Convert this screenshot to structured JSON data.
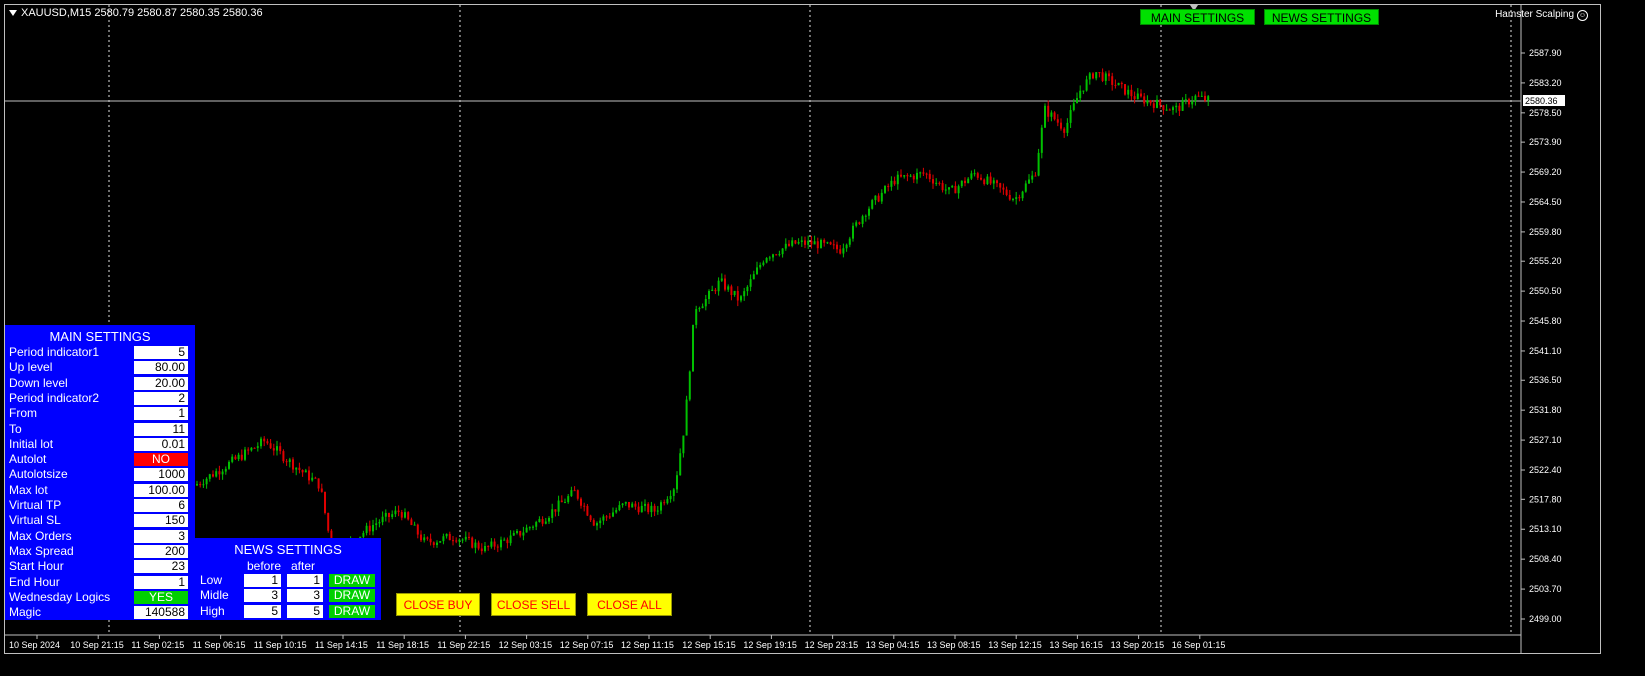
{
  "symbol_header": "XAUUSD,M15  2580.79 2580.87 2580.35 2580.36",
  "ea_name": "Hamster Scalping",
  "top_buttons": {
    "main": "MAIN SETTINGS",
    "news": "NEWS SETTINGS"
  },
  "current_price": "2580.36",
  "colors": {
    "bull": "#00c000",
    "bear": "#e00000",
    "panel": "#0000ff",
    "button_green": "#00e000",
    "button_yellow": "#ffff00"
  },
  "price_axis": [
    "2587.90",
    "2583.20",
    "2578.50",
    "2573.90",
    "2569.20",
    "2564.50",
    "2559.80",
    "2555.20",
    "2550.50",
    "2545.80",
    "2541.10",
    "2536.50",
    "2531.80",
    "2527.10",
    "2522.40",
    "2517.80",
    "2513.10",
    "2508.40",
    "2503.70",
    "2499.00"
  ],
  "time_axis": [
    "10 Sep 2024",
    "10 Sep 21:15",
    "11 Sep 02:15",
    "11 Sep 06:15",
    "11 Sep 10:15",
    "11 Sep 14:15",
    "11 Sep 18:15",
    "11 Sep 22:15",
    "12 Sep 03:15",
    "12 Sep 07:15",
    "12 Sep 11:15",
    "12 Sep 15:15",
    "12 Sep 19:15",
    "12 Sep 23:15",
    "13 Sep 04:15",
    "13 Sep 08:15",
    "13 Sep 12:15",
    "13 Sep 16:15",
    "13 Sep 20:15",
    "16 Sep 01:15"
  ],
  "main_settings": {
    "title": "MAIN SETTINGS",
    "rows": [
      {
        "label": "Period indicator1",
        "value": "5"
      },
      {
        "label": "Up level",
        "value": "80.00"
      },
      {
        "label": "Down level",
        "value": "20.00"
      },
      {
        "label": "Period indicator2",
        "value": "2"
      },
      {
        "label": "From",
        "value": "1"
      },
      {
        "label": "To",
        "value": "11"
      },
      {
        "label": "Initial lot",
        "value": "0.01"
      },
      {
        "label": "Autolot",
        "value": "NO"
      },
      {
        "label": "Autolotsize",
        "value": "1000"
      },
      {
        "label": "Max lot",
        "value": "100.00"
      },
      {
        "label": "Virtual TP",
        "value": "6"
      },
      {
        "label": "Virtual SL",
        "value": "150"
      },
      {
        "label": "Max Orders",
        "value": "3"
      },
      {
        "label": "Max Spread",
        "value": "200"
      },
      {
        "label": "Start Hour",
        "value": "23"
      },
      {
        "label": "End Hour",
        "value": "1"
      },
      {
        "label": "Wednesday Logics",
        "value": "YES"
      },
      {
        "label": "Magic",
        "value": "140588"
      }
    ]
  },
  "news_settings": {
    "title": "NEWS SETTINGS",
    "col_before": "before",
    "col_after": "after",
    "rows": [
      {
        "label": "Low",
        "before": "1",
        "after": "1",
        "button": "DRAW"
      },
      {
        "label": "Midle",
        "before": "3",
        "after": "3",
        "button": "DRAW"
      },
      {
        "label": "High",
        "before": "5",
        "after": "5",
        "button": "DRAW"
      }
    ]
  },
  "action_buttons": {
    "close_buy": "CLOSE BUY",
    "close_sell": "CLOSE SELL",
    "close_all": "CLOSE ALL"
  }
}
